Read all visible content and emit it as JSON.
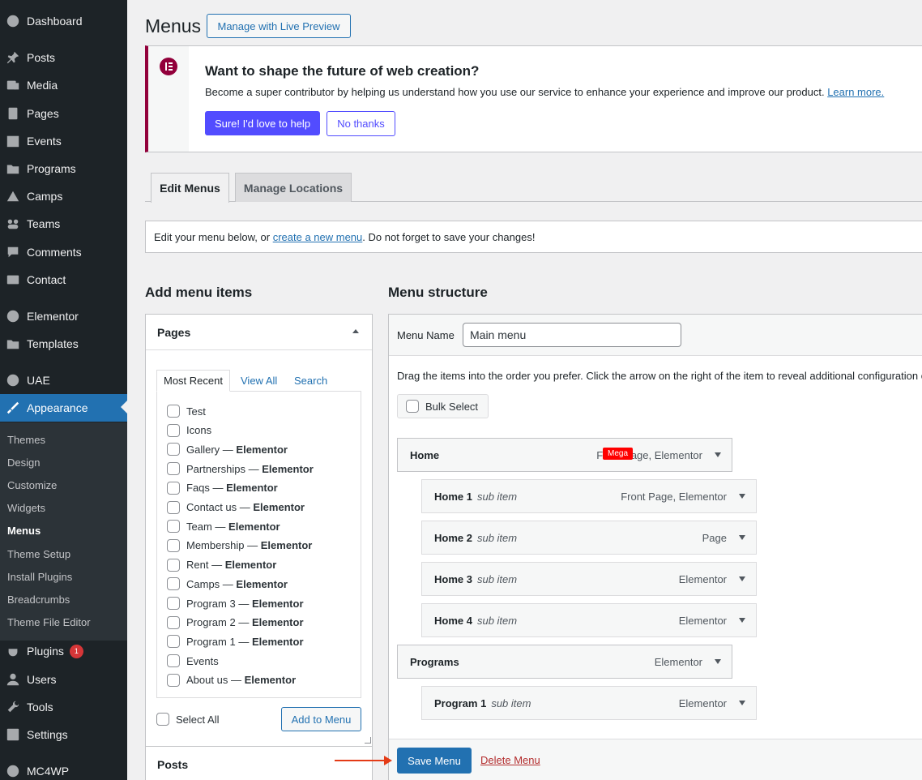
{
  "sidebar": {
    "items": [
      {
        "label": "Dashboard",
        "icon": "dashboard-icon"
      },
      {
        "label": "Posts",
        "icon": "pin-icon"
      },
      {
        "label": "Media",
        "icon": "media-icon"
      },
      {
        "label": "Pages",
        "icon": "pages-icon"
      },
      {
        "label": "Events",
        "icon": "calendar-icon"
      },
      {
        "label": "Programs",
        "icon": "folder-icon"
      },
      {
        "label": "Camps",
        "icon": "camp-icon"
      },
      {
        "label": "Teams",
        "icon": "groups-icon"
      },
      {
        "label": "Comments",
        "icon": "comment-icon"
      },
      {
        "label": "Contact",
        "icon": "mail-icon"
      },
      {
        "label": "Elementor",
        "icon": "elementor-icon"
      },
      {
        "label": "Templates",
        "icon": "folder-icon"
      },
      {
        "label": "UAE",
        "icon": "uae-icon"
      },
      {
        "label": "Appearance",
        "icon": "brush-icon"
      },
      {
        "label": "Plugins",
        "icon": "plugin-icon",
        "badge": "1"
      },
      {
        "label": "Users",
        "icon": "user-icon"
      },
      {
        "label": "Tools",
        "icon": "wrench-icon"
      },
      {
        "label": "Settings",
        "icon": "settings-icon"
      },
      {
        "label": "MC4WP",
        "icon": "mc4wp-icon"
      }
    ],
    "submenu": [
      "Themes",
      "Design",
      "Customize",
      "Widgets",
      "Menus",
      "Theme Setup",
      "Install Plugins",
      "Breadcrumbs",
      "Theme File Editor"
    ],
    "active_color": "#2271b1"
  },
  "header": {
    "title": "Menus",
    "live_preview_label": "Manage with Live Preview"
  },
  "notice": {
    "heading": "Want to shape the future of web creation?",
    "text": "Become a super contributor by helping us understand how you use our service to enhance your experience and improve our product.",
    "learn_more": "Learn more.",
    "accept_label": "Sure! I'd love to help",
    "decline_label": "No thanks",
    "accent_color": "#92003b"
  },
  "tabs": {
    "edit": "Edit Menus",
    "locations": "Manage Locations"
  },
  "help": {
    "prefix": "Edit your menu below, or ",
    "link": "create a new menu",
    "suffix": ". Do not forget to save your changes!"
  },
  "add_items": {
    "heading": "Add menu items",
    "pages_title": "Pages",
    "tabs": [
      "Most Recent",
      "View All",
      "Search"
    ],
    "pages": [
      {
        "name": "Test",
        "suffix": ""
      },
      {
        "name": "Icons",
        "suffix": ""
      },
      {
        "name": "Gallery",
        "suffix": "Elementor"
      },
      {
        "name": "Partnerships",
        "suffix": "Elementor"
      },
      {
        "name": "Faqs",
        "suffix": "Elementor"
      },
      {
        "name": "Contact us",
        "suffix": "Elementor"
      },
      {
        "name": "Team",
        "suffix": "Elementor"
      },
      {
        "name": "Membership",
        "suffix": "Elementor"
      },
      {
        "name": "Rent",
        "suffix": "Elementor"
      },
      {
        "name": "Camps",
        "suffix": "Elementor"
      },
      {
        "name": "Program 3",
        "suffix": "Elementor"
      },
      {
        "name": "Program 2",
        "suffix": "Elementor"
      },
      {
        "name": "Program 1",
        "suffix": "Elementor"
      },
      {
        "name": "Events",
        "suffix": ""
      },
      {
        "name": "About us",
        "suffix": "Elementor"
      }
    ],
    "dash": " — ",
    "select_all": "Select All",
    "add_button": "Add to Menu",
    "posts_title": "Posts"
  },
  "structure": {
    "heading": "Menu structure",
    "name_label": "Menu Name",
    "name_value": "Main menu",
    "drag_help": "Drag the items into the order you prefer. Click the arrow on the right of the item to reveal additional configuration options.",
    "bulk_select": "Bulk Select",
    "sub_label": "sub item",
    "mega_badge": "Mega",
    "items": [
      {
        "title": "Home",
        "type": "Front Page, Elementor",
        "sub": false
      },
      {
        "title": "Home 1",
        "type": "Front Page, Elementor",
        "sub": true
      },
      {
        "title": "Home 2",
        "type": "Page",
        "sub": true
      },
      {
        "title": "Home 3",
        "type": "Elementor",
        "sub": true
      },
      {
        "title": "Home 4",
        "type": "Elementor",
        "sub": true
      },
      {
        "title": "Programs",
        "type": "Elementor",
        "sub": false
      },
      {
        "title": "Program 1",
        "type": "Elementor",
        "sub": true
      }
    ],
    "save_label": "Save Menu",
    "delete_label": "Delete Menu"
  }
}
